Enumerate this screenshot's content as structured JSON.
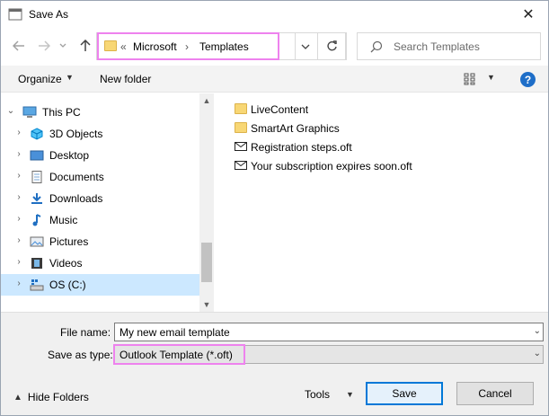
{
  "window": {
    "title": "Save As",
    "close_glyph": "✕"
  },
  "address": {
    "prefix": "«",
    "crumbs": [
      "Microsoft",
      "Templates"
    ],
    "separator": "›"
  },
  "search": {
    "placeholder": "Search Templates"
  },
  "toolbar": {
    "organize": "Organize",
    "new_folder": "New folder",
    "help": "?"
  },
  "tree": {
    "items": [
      {
        "label": "This PC",
        "icon": "pc-icon",
        "expanded": true
      },
      {
        "label": "3D Objects",
        "icon": "cube-icon"
      },
      {
        "label": "Desktop",
        "icon": "desktop-icon"
      },
      {
        "label": "Documents",
        "icon": "documents-icon"
      },
      {
        "label": "Downloads",
        "icon": "download-icon"
      },
      {
        "label": "Music",
        "icon": "music-icon"
      },
      {
        "label": "Pictures",
        "icon": "pictures-icon"
      },
      {
        "label": "Videos",
        "icon": "videos-icon"
      },
      {
        "label": "OS (C:)",
        "icon": "drive-icon",
        "selected": true
      }
    ]
  },
  "files": [
    {
      "name": "LiveContent",
      "type": "folder"
    },
    {
      "name": "SmartArt Graphics",
      "type": "folder"
    },
    {
      "name": "Registration steps.oft",
      "type": "mail"
    },
    {
      "name": "Your subscription expires soon.oft",
      "type": "mail"
    }
  ],
  "form": {
    "file_name_label": "File name:",
    "file_name_value": "My new email template",
    "save_type_label": "Save as type:",
    "save_type_value": "Outlook Template (*.oft)"
  },
  "footer": {
    "hide_folders": "Hide Folders",
    "tools": "Tools",
    "save": "Save",
    "cancel": "Cancel"
  },
  "colors": {
    "accent": "#0078d7",
    "highlight": "#ee82ee",
    "selected": "#cce8ff",
    "folder": "#f8d775"
  }
}
